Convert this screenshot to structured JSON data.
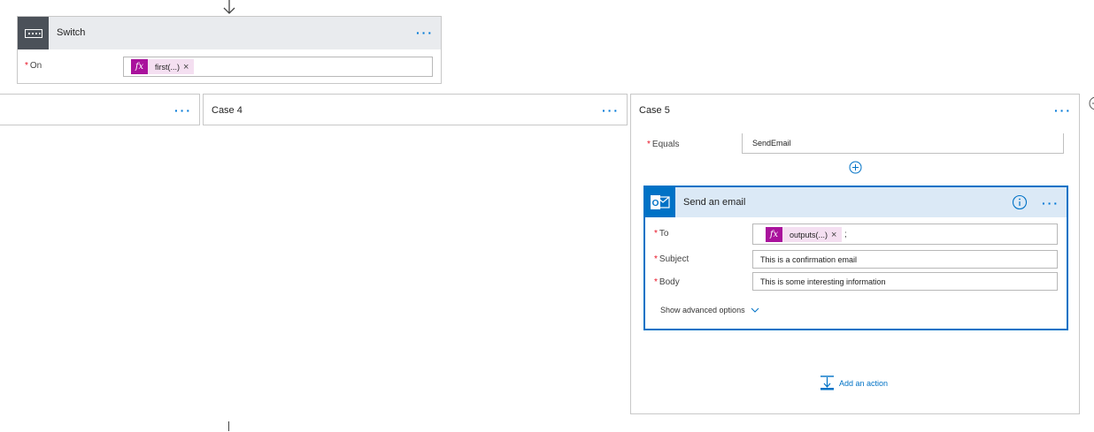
{
  "switch": {
    "title": "Switch",
    "on_label": "On",
    "on_token": "first(...)",
    "token_remove": "×"
  },
  "cases": {
    "case4_title": "Case 4",
    "case5_title": "Case 5"
  },
  "case5": {
    "equals_label": "Equals",
    "equals_value": "SendEmail"
  },
  "email": {
    "title": "Send an email",
    "to_label": "To",
    "to_token": "outputs(...)",
    "to_separator": ";",
    "subject_label": "Subject",
    "subject_value": "This is a confirmation email",
    "body_label": "Body",
    "body_value": "This is some interesting information",
    "advanced_label": "Show advanced options"
  },
  "add_action_label": "Add an action",
  "required_mark": "*",
  "colors": {
    "accent": "#0072c6",
    "expression": "#a9129c",
    "required": "#e81123",
    "switch_header": "#4b5159"
  },
  "icons": {
    "switch": "switch-icon",
    "outlook": "outlook-icon",
    "expression": "fx-icon",
    "info": "info-icon",
    "add_action": "add-action-icon"
  }
}
